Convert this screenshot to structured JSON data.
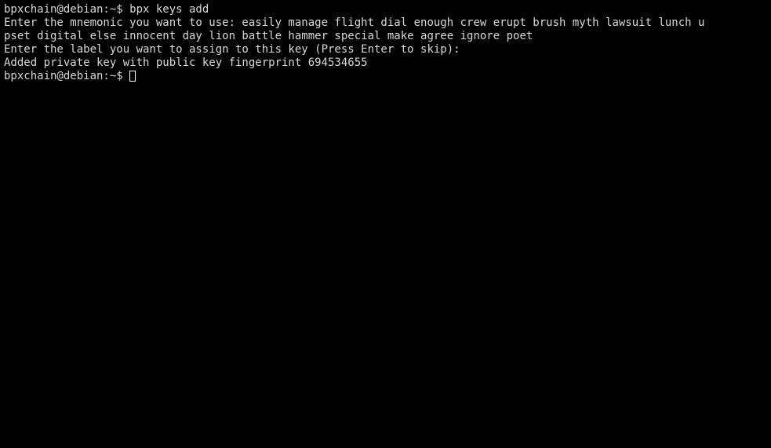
{
  "terminal": {
    "background_color": "#000000",
    "foreground_color": "#d8d8d8",
    "cursor_color": "#ffffff",
    "prompt": "bpxchain@debian:~$",
    "lines": [
      {
        "id": "command-line",
        "text": "bpxchain@debian:~$ bpx keys add"
      },
      {
        "id": "mnemonic-prompt-line-1",
        "text": "Enter the mnemonic you want to use: easily manage flight dial enough crew erupt brush myth lawsuit lunch u"
      },
      {
        "id": "mnemonic-prompt-line-2",
        "text": "pset digital else innocent day lion battle hammer special make agree ignore poet"
      },
      {
        "id": "label-prompt-line",
        "text": "Enter the label you want to assign to this key (Press Enter to skip):"
      },
      {
        "id": "result-line",
        "text": "Added private key with public key fingerprint 694534655"
      }
    ],
    "final_prompt": "bpxchain@debian:~$ ",
    "command": "bpx keys add",
    "mnemonic_words": [
      "easily",
      "manage",
      "flight",
      "dial",
      "enough",
      "crew",
      "erupt",
      "brush",
      "myth",
      "lawsuit",
      "lunch",
      "upset",
      "digital",
      "else",
      "innocent",
      "day",
      "lion",
      "battle",
      "hammer",
      "special",
      "make",
      "agree",
      "ignore",
      "poet"
    ],
    "fingerprint": "694534655",
    "cursor": {
      "style": "hollow-block",
      "visible": true
    }
  }
}
